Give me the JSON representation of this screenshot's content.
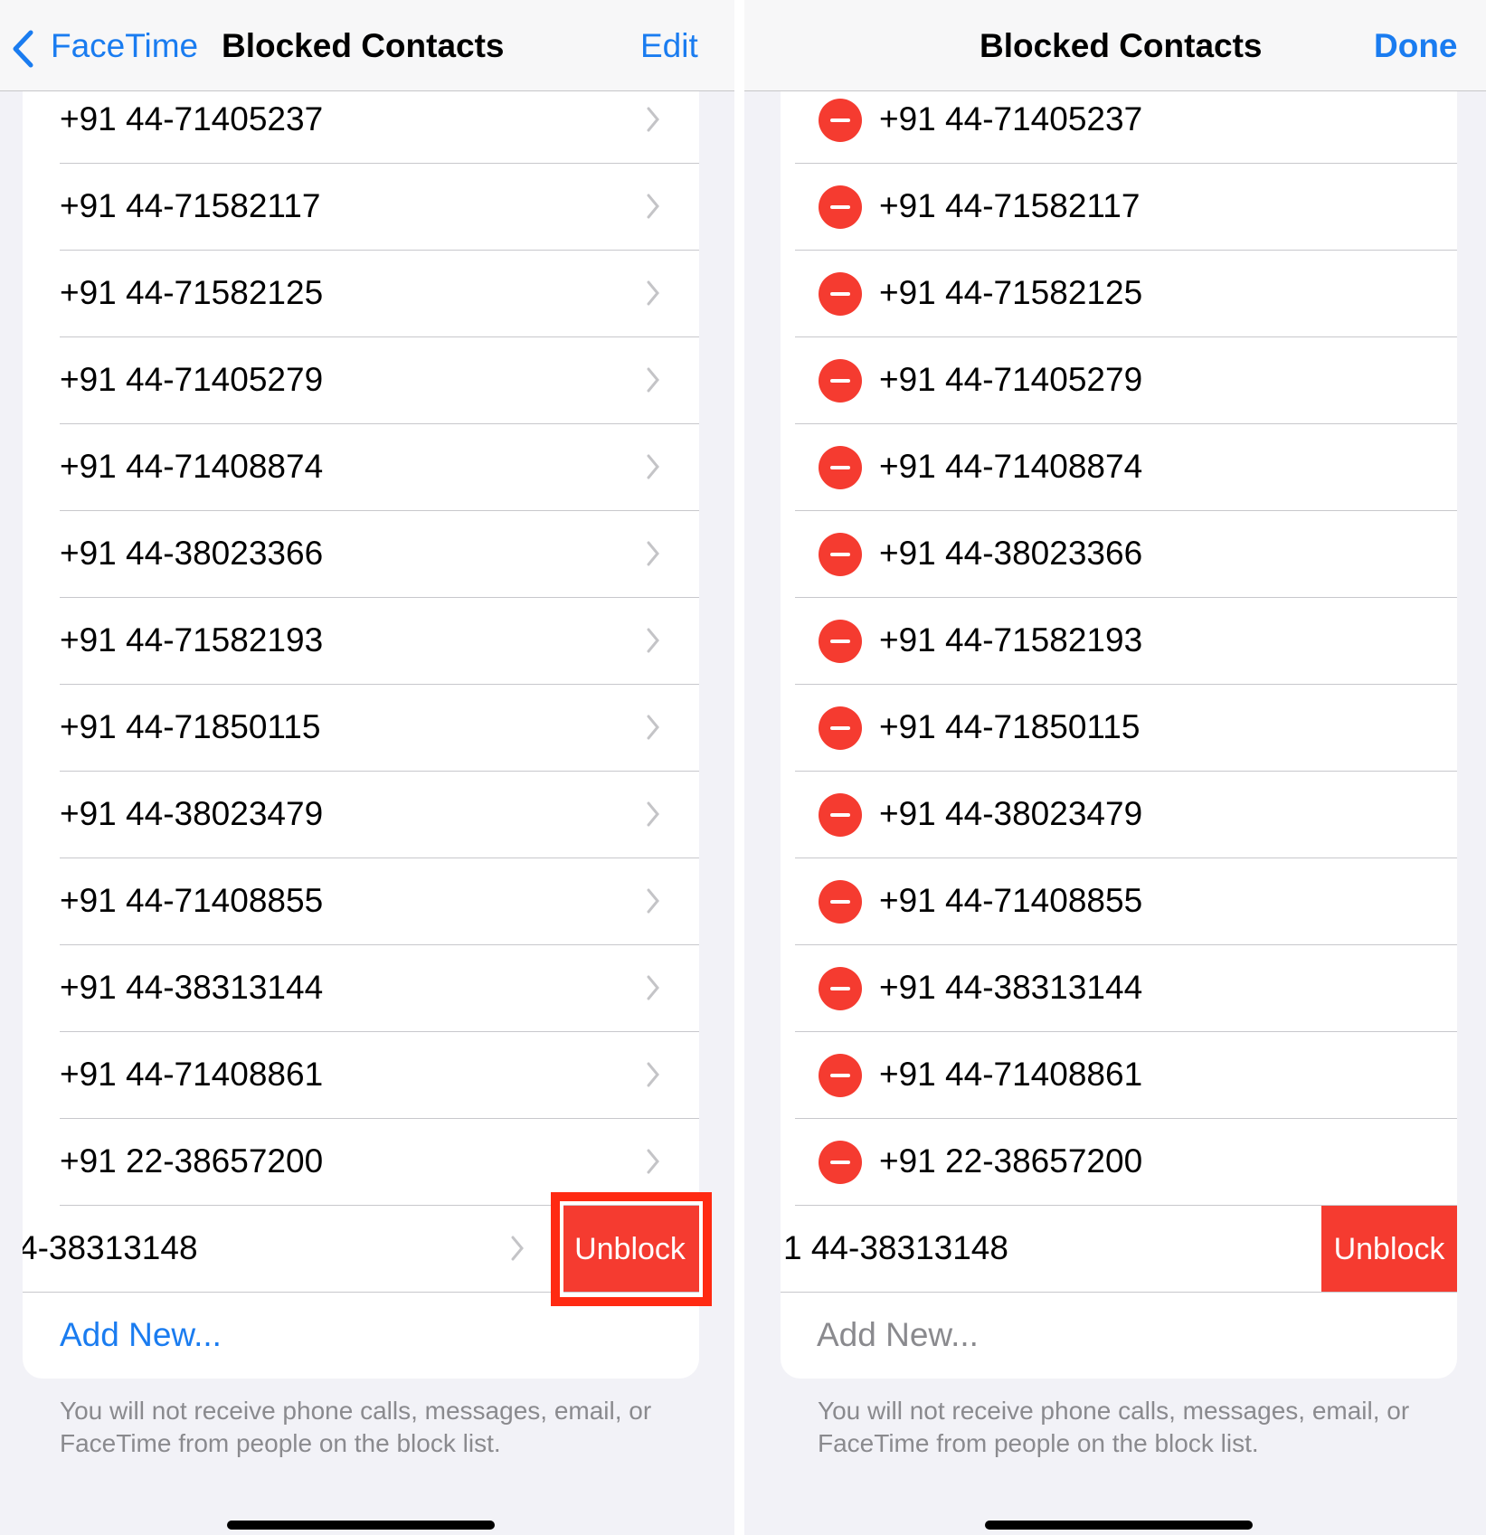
{
  "left": {
    "back_label": "FaceTime",
    "title": "Blocked Contacts",
    "action_label": "Edit",
    "add_new": "Add New...",
    "swiped_number_visible": "4-38313148",
    "unblock_label": "Unblock"
  },
  "right": {
    "title": "Blocked Contacts",
    "action_label": "Done",
    "add_new": "Add New...",
    "swiped_number_visible": "1 44-38313148",
    "unblock_label": "Unblock"
  },
  "contacts": [
    "+91 44-71405237",
    "+91 44-71582117",
    "+91 44-71582125",
    "+91 44-71405279",
    "+91 44-71408874",
    "+91 44-38023366",
    "+91 44-71582193",
    "+91 44-71850115",
    "+91 44-38023479",
    "+91 44-71408855",
    "+91 44-38313144",
    "+91 44-71408861",
    "+91 22-38657200"
  ],
  "footer": "You will not receive phone calls, messages, email, or FaceTime from people on the block list.",
  "colors": {
    "accent": "#1a7cf0",
    "destructive": "#f53b30",
    "highlight": "#ff2a12"
  }
}
